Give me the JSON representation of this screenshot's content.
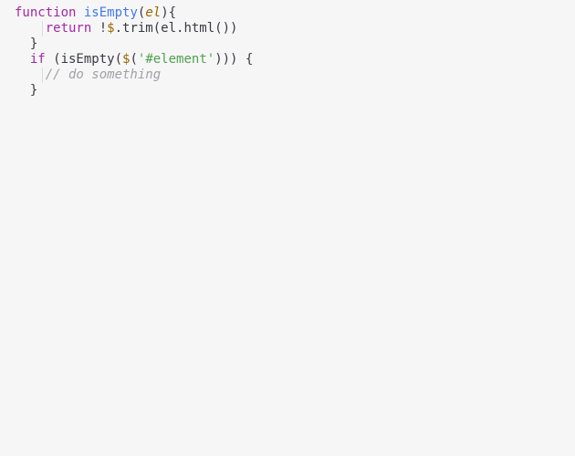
{
  "code": {
    "line1": {
      "kw_function": "function",
      "fn_name": "isEmpty",
      "paren_open": "(",
      "param": "el",
      "paren_close_brace": "){"
    },
    "line2": {
      "kw_return": "return",
      "bang": " !",
      "dollar": "$",
      "dot_trim": ".trim(el.html())"
    },
    "line3": {
      "brace_close": "}"
    },
    "line4": {
      "kw_if": "if",
      "open": " (isEmpty(",
      "dollar": "$",
      "paren_open": "(",
      "str": "'#element'",
      "close": "))) {"
    },
    "line5": {
      "comment": "// do something"
    },
    "line6": {
      "brace_close": "}"
    }
  }
}
